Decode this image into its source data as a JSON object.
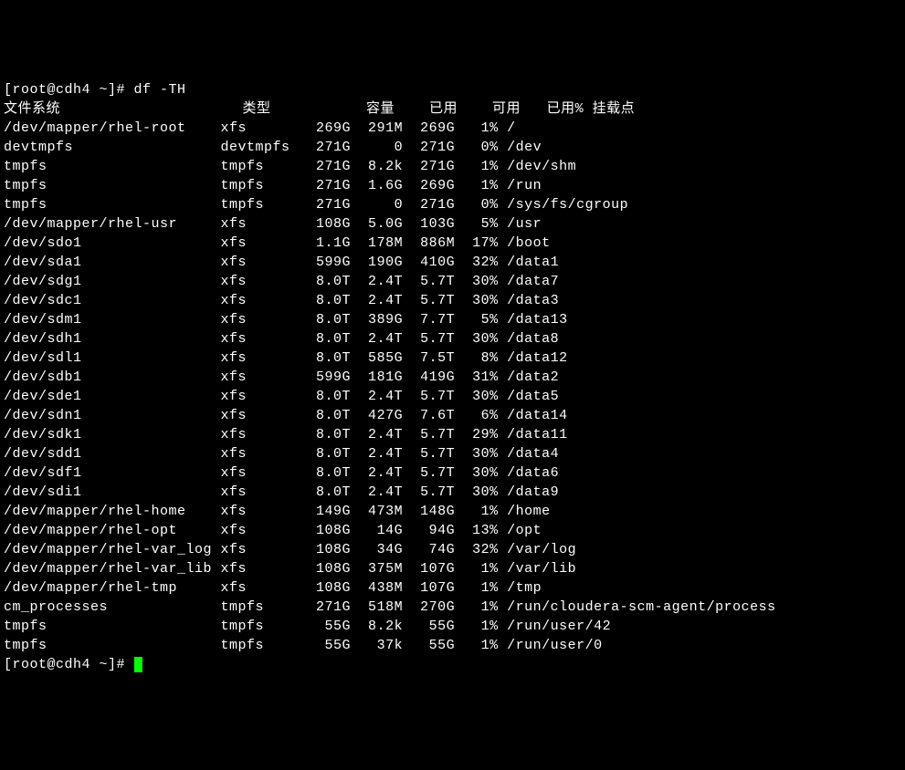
{
  "prompt_line": "[root@cdh4 ~]# df -TH",
  "headers": {
    "filesystem": "文件系统",
    "type": "类型",
    "size": "容量",
    "used": "已用",
    "avail": "可用",
    "use_pct": "已用%",
    "mounted": "挂载点"
  },
  "rows": [
    {
      "fs": "/dev/mapper/rhel-root",
      "type": "xfs",
      "size": "269G",
      "used": "291M",
      "avail": "269G",
      "pct": "1%",
      "mount": "/"
    },
    {
      "fs": "devtmpfs",
      "type": "devtmpfs",
      "size": "271G",
      "used": "0",
      "avail": "271G",
      "pct": "0%",
      "mount": "/dev"
    },
    {
      "fs": "tmpfs",
      "type": "tmpfs",
      "size": "271G",
      "used": "8.2k",
      "avail": "271G",
      "pct": "1%",
      "mount": "/dev/shm"
    },
    {
      "fs": "tmpfs",
      "type": "tmpfs",
      "size": "271G",
      "used": "1.6G",
      "avail": "269G",
      "pct": "1%",
      "mount": "/run"
    },
    {
      "fs": "tmpfs",
      "type": "tmpfs",
      "size": "271G",
      "used": "0",
      "avail": "271G",
      "pct": "0%",
      "mount": "/sys/fs/cgroup"
    },
    {
      "fs": "/dev/mapper/rhel-usr",
      "type": "xfs",
      "size": "108G",
      "used": "5.0G",
      "avail": "103G",
      "pct": "5%",
      "mount": "/usr"
    },
    {
      "fs": "/dev/sdo1",
      "type": "xfs",
      "size": "1.1G",
      "used": "178M",
      "avail": "886M",
      "pct": "17%",
      "mount": "/boot"
    },
    {
      "fs": "/dev/sda1",
      "type": "xfs",
      "size": "599G",
      "used": "190G",
      "avail": "410G",
      "pct": "32%",
      "mount": "/data1"
    },
    {
      "fs": "/dev/sdg1",
      "type": "xfs",
      "size": "8.0T",
      "used": "2.4T",
      "avail": "5.7T",
      "pct": "30%",
      "mount": "/data7"
    },
    {
      "fs": "/dev/sdc1",
      "type": "xfs",
      "size": "8.0T",
      "used": "2.4T",
      "avail": "5.7T",
      "pct": "30%",
      "mount": "/data3"
    },
    {
      "fs": "/dev/sdm1",
      "type": "xfs",
      "size": "8.0T",
      "used": "389G",
      "avail": "7.7T",
      "pct": "5%",
      "mount": "/data13"
    },
    {
      "fs": "/dev/sdh1",
      "type": "xfs",
      "size": "8.0T",
      "used": "2.4T",
      "avail": "5.7T",
      "pct": "30%",
      "mount": "/data8"
    },
    {
      "fs": "/dev/sdl1",
      "type": "xfs",
      "size": "8.0T",
      "used": "585G",
      "avail": "7.5T",
      "pct": "8%",
      "mount": "/data12"
    },
    {
      "fs": "/dev/sdb1",
      "type": "xfs",
      "size": "599G",
      "used": "181G",
      "avail": "419G",
      "pct": "31%",
      "mount": "/data2"
    },
    {
      "fs": "/dev/sde1",
      "type": "xfs",
      "size": "8.0T",
      "used": "2.4T",
      "avail": "5.7T",
      "pct": "30%",
      "mount": "/data5"
    },
    {
      "fs": "/dev/sdn1",
      "type": "xfs",
      "size": "8.0T",
      "used": "427G",
      "avail": "7.6T",
      "pct": "6%",
      "mount": "/data14"
    },
    {
      "fs": "/dev/sdk1",
      "type": "xfs",
      "size": "8.0T",
      "used": "2.4T",
      "avail": "5.7T",
      "pct": "29%",
      "mount": "/data11"
    },
    {
      "fs": "/dev/sdd1",
      "type": "xfs",
      "size": "8.0T",
      "used": "2.4T",
      "avail": "5.7T",
      "pct": "30%",
      "mount": "/data4"
    },
    {
      "fs": "/dev/sdf1",
      "type": "xfs",
      "size": "8.0T",
      "used": "2.4T",
      "avail": "5.7T",
      "pct": "30%",
      "mount": "/data6"
    },
    {
      "fs": "/dev/sdi1",
      "type": "xfs",
      "size": "8.0T",
      "used": "2.4T",
      "avail": "5.7T",
      "pct": "30%",
      "mount": "/data9"
    },
    {
      "fs": "/dev/mapper/rhel-home",
      "type": "xfs",
      "size": "149G",
      "used": "473M",
      "avail": "148G",
      "pct": "1%",
      "mount": "/home"
    },
    {
      "fs": "/dev/mapper/rhel-opt",
      "type": "xfs",
      "size": "108G",
      "used": "14G",
      "avail": "94G",
      "pct": "13%",
      "mount": "/opt"
    },
    {
      "fs": "/dev/mapper/rhel-var_log",
      "type": "xfs",
      "size": "108G",
      "used": "34G",
      "avail": "74G",
      "pct": "32%",
      "mount": "/var/log"
    },
    {
      "fs": "/dev/mapper/rhel-var_lib",
      "type": "xfs",
      "size": "108G",
      "used": "375M",
      "avail": "107G",
      "pct": "1%",
      "mount": "/var/lib"
    },
    {
      "fs": "/dev/mapper/rhel-tmp",
      "type": "xfs",
      "size": "108G",
      "used": "438M",
      "avail": "107G",
      "pct": "1%",
      "mount": "/tmp"
    },
    {
      "fs": "cm_processes",
      "type": "tmpfs",
      "size": "271G",
      "used": "518M",
      "avail": "270G",
      "pct": "1%",
      "mount": "/run/cloudera-scm-agent/process"
    },
    {
      "fs": "tmpfs",
      "type": "tmpfs",
      "size": "55G",
      "used": "8.2k",
      "avail": "55G",
      "pct": "1%",
      "mount": "/run/user/42"
    },
    {
      "fs": "tmpfs",
      "type": "tmpfs",
      "size": "55G",
      "used": "37k",
      "avail": "55G",
      "pct": "1%",
      "mount": "/run/user/0"
    }
  ],
  "end_prompt": "[root@cdh4 ~]# "
}
